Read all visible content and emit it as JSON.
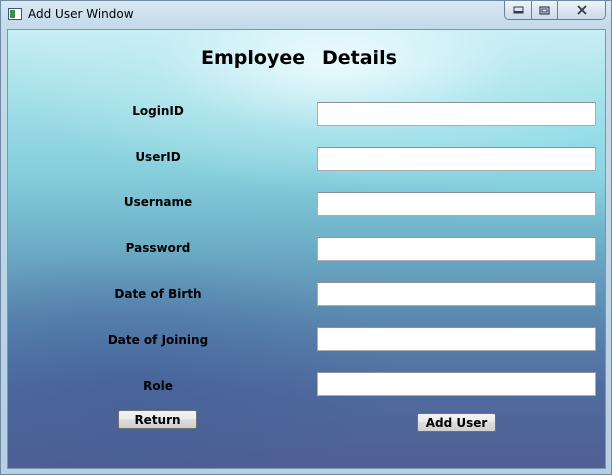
{
  "window": {
    "title": "Add User Window",
    "controls": {
      "minimize": "▭",
      "maximize": "▢",
      "close": "✕"
    }
  },
  "form": {
    "heading_left": "Employee",
    "heading_right": "Details",
    "fields": [
      {
        "label": "LoginID",
        "value": ""
      },
      {
        "label": "UserID",
        "value": ""
      },
      {
        "label": "Username",
        "value": ""
      },
      {
        "label": "Password",
        "value": ""
      },
      {
        "label": "Date of Birth",
        "value": ""
      },
      {
        "label": "Date of Joining",
        "value": ""
      },
      {
        "label": "Role",
        "value": ""
      }
    ],
    "return_label": "Return",
    "add_user_label": "Add User"
  },
  "colors": {
    "gradient_top": "#c7eef3",
    "gradient_bottom": "#4f5f93",
    "field_border": "#abadb3"
  }
}
